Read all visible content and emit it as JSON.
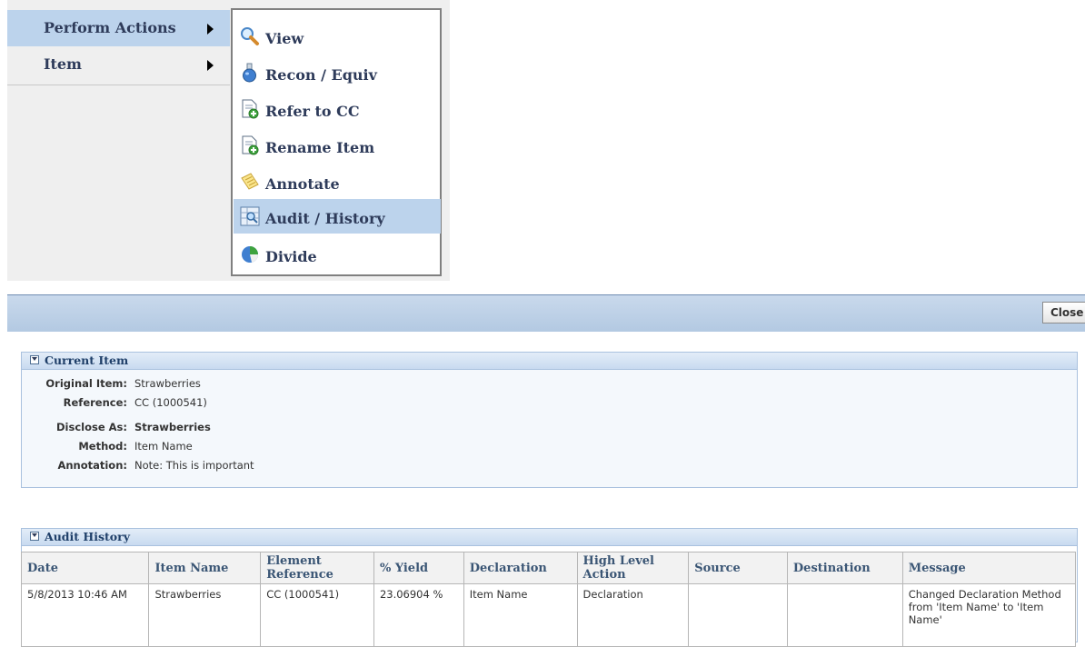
{
  "menu": {
    "items": [
      {
        "label": "Perform Actions"
      },
      {
        "label": "Item"
      }
    ],
    "submenu": [
      {
        "label": "View",
        "icon": "magnifier-icon"
      },
      {
        "label": "Recon / Equiv",
        "icon": "flask-icon"
      },
      {
        "label": "Refer to CC",
        "icon": "document-add-icon"
      },
      {
        "label": "Rename Item",
        "icon": "document-add-icon"
      },
      {
        "label": "Annotate",
        "icon": "notes-icon"
      },
      {
        "label": "Audit / History",
        "icon": "audit-history-icon"
      },
      {
        "label": "Divide",
        "icon": "pie-chart-icon"
      }
    ]
  },
  "toolbar": {
    "close_label": "Close"
  },
  "current_item": {
    "title": "Current Item",
    "fields": [
      {
        "label": "Original Item:",
        "value": "Strawberries"
      },
      {
        "label": "Reference:",
        "value": "CC (1000541)"
      },
      {
        "label": "Disclose As:",
        "value": "Strawberries"
      },
      {
        "label": "Method:",
        "value": "Item Name"
      },
      {
        "label": "Annotation:",
        "value": "Note: This is important"
      }
    ]
  },
  "audit_history": {
    "title": "Audit History",
    "columns": [
      "Date",
      "Item Name",
      "Element Reference",
      "% Yield",
      "Declaration",
      "High Level Action",
      "Source",
      "Destination",
      "Message"
    ],
    "rows": [
      [
        "5/8/2013 10:46 AM",
        "Strawberries",
        "CC (1000541)",
        "23.06904 %",
        "Item Name",
        "Declaration",
        "",
        "",
        "Changed Declaration Method from 'Item Name' to 'Item Name'"
      ]
    ]
  },
  "colors": {
    "accent": "#bcd3ec",
    "header_bar": "#b3c9e2",
    "section_border": "#a9c1de",
    "menu_text": "#2e3b5a"
  }
}
